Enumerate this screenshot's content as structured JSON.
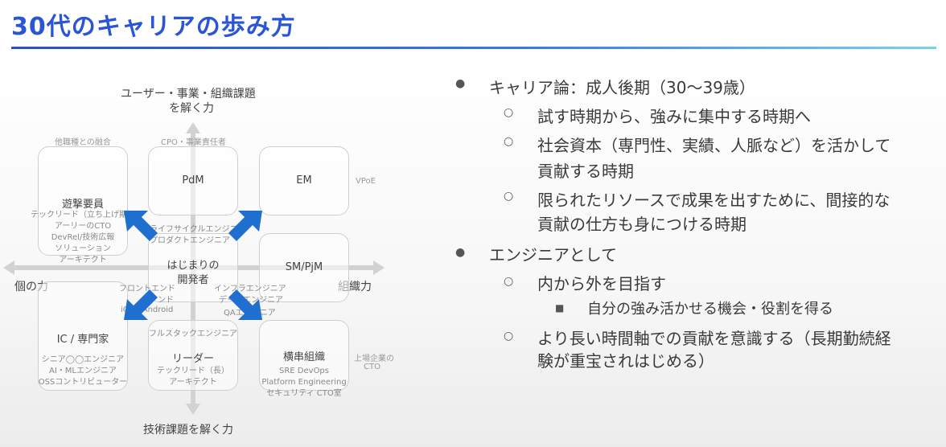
{
  "slide": {
    "title": "30代のキャリアの歩み方"
  },
  "diagram": {
    "top_label_1": "ユーザー・事業・組織課題",
    "top_label_2": "を解く力",
    "bottom_label": "技術課題を解く力",
    "left_label": "個の力",
    "right_label": "組織力",
    "upper_left_note": "他職種との融合",
    "top_center_note": "CPO・事業責任者",
    "right_note_vpoe": "VPoE",
    "right_note_cto_1": "上場企業の",
    "right_note_cto_2": "CTO",
    "boxes": {
      "guerrilla": {
        "title": "遊撃要員",
        "lines": [
          "テックリード（立ち上げ期）",
          "アーリーのCTO",
          "DevRel/技術広報",
          "ソリューション",
          "アーキテクト"
        ]
      },
      "pdm": {
        "title": "PdM"
      },
      "em": {
        "title": "EM"
      },
      "beginner": {
        "title_1": "はじまりの",
        "title_2": "開発者",
        "over_1": "ライフサイクルエンジニア",
        "over_2": "プロダクトエンジニア"
      },
      "smpjm": {
        "title": "SM/PjM"
      },
      "ic": {
        "title": "IC / 専門家",
        "lines": [
          "シニア◯◯エンジニア",
          "AI・MLエンジニア",
          "OSSコントリビューター"
        ]
      },
      "leader": {
        "top": "フルスタックエンジニア",
        "title": "リーダー",
        "lines": [
          "テックリード（長）",
          "アーキテクト"
        ]
      },
      "cross": {
        "title": "横串組織",
        "lines": [
          "SRE DevOps",
          "Platform Engineering",
          "セキュリティ CTO室"
        ]
      }
    },
    "mid_labels": {
      "frontend": "フロントエンド",
      "backend_frag": "ンド",
      "android": "iOS / Android",
      "infra": "インフラエンジニア",
      "data": "データエンジニア",
      "qa": "QAエンジニア"
    }
  },
  "bullets": [
    {
      "level": 1,
      "text": "キャリア論：成人後期（30〜39歳）"
    },
    {
      "level": 2,
      "text": "試す時期から、強みに集中する時期へ"
    },
    {
      "level": 2,
      "text": "社会資本（専門性、実績、人脈など）を活かして"
    },
    {
      "level": 2,
      "text": "貢献する時期",
      "continuation": true
    },
    {
      "level": 2,
      "text": "限られたリソースで成果を出すために、間接的な"
    },
    {
      "level": 2,
      "text": "貢献の仕方も身につける時期",
      "continuation": true
    },
    {
      "level": 1,
      "text": "エンジニアとして"
    },
    {
      "level": 2,
      "text": "内から外を目指す"
    },
    {
      "level": 3,
      "text": "自分の強み活かせる機会・役割を得る"
    },
    {
      "level": 2,
      "text": "より長い時間軸での貢献を意識する（長期勤続経"
    },
    {
      "level": 2,
      "text": "験が重宝されはじめる）",
      "continuation": true
    }
  ],
  "colors": {
    "title": "#2a55d6",
    "arrow_blue": "#1f6fd0",
    "axis_gray": "#cfcfcf"
  }
}
